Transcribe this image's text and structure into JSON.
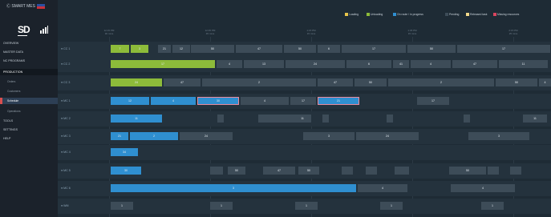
{
  "app": {
    "brand": "Ⓒ SMART MES",
    "logo_text": "SD"
  },
  "sidebar": {
    "items": [
      {
        "label": "OVERVIEW"
      },
      {
        "label": "MASTER DATA"
      },
      {
        "label": "NC PROGRAMS"
      },
      {
        "label": "PRODUCTION"
      },
      {
        "label": "Orders"
      },
      {
        "label": "Customers"
      },
      {
        "label": "Schedule"
      },
      {
        "label": "Operations"
      },
      {
        "label": "TOOLS"
      },
      {
        "label": "SETTINGS"
      },
      {
        "label": "HELP"
      }
    ]
  },
  "legend": {
    "items": [
      {
        "label": "Loading",
        "color": "#e8c54a"
      },
      {
        "label": "Unloading",
        "color": "#8dbb3a"
      },
      {
        "label": "On route / in progress",
        "color": "#2f8fd0"
      },
      {
        "label": "Pending",
        "color": "#3d4c58"
      },
      {
        "label": "Released task",
        "color": "#f2d98a"
      },
      {
        "label": "Missing resources",
        "color": "#d9455f"
      }
    ]
  },
  "timeline": {
    "ticks": [
      {
        "time": "12:15 PM",
        "sub": "30 mins"
      },
      {
        "time": "12:45 PM",
        "sub": "45 mins"
      },
      {
        "time": "1:15 PM",
        "sub": "15 mins"
      },
      {
        "time": "1:45 PM",
        "sub": "15 mins"
      },
      {
        "time": "2:15 PM",
        "sub": "25 mins"
      }
    ]
  },
  "rows": [
    {
      "label": "● CC 1",
      "bars": [
        {
          "text": "7",
          "kind": "g"
        },
        {
          "text": "3",
          "kind": "g"
        },
        {
          "text": "21",
          "kind": "d"
        },
        {
          "text": "12",
          "kind": "d"
        },
        {
          "text": "50",
          "kind": "d"
        },
        {
          "text": "47",
          "kind": "d"
        },
        {
          "text": "50",
          "kind": "d"
        },
        {
          "text": "6",
          "kind": "d"
        },
        {
          "text": "17",
          "kind": "d"
        },
        {
          "text": "50",
          "kind": "d"
        },
        {
          "text": "17",
          "kind": "d"
        }
      ]
    },
    {
      "label": "● CC 2",
      "bars": [
        {
          "text": "17",
          "kind": "g"
        },
        {
          "text": "4",
          "kind": "d"
        },
        {
          "text": "13",
          "kind": "d"
        },
        {
          "text": "24",
          "kind": "d"
        },
        {
          "text": "6",
          "kind": "d"
        },
        {
          "text": "41",
          "kind": "d"
        },
        {
          "text": "4",
          "kind": "d"
        },
        {
          "text": "47",
          "kind": "d"
        },
        {
          "text": "11",
          "kind": "d"
        }
      ]
    },
    {
      "label": "● CC 3",
      "bars": [
        {
          "text": "24",
          "kind": "g"
        },
        {
          "text": "47",
          "kind": "d"
        },
        {
          "text": "2",
          "kind": "d"
        },
        {
          "text": "47",
          "kind": "d"
        },
        {
          "text": "50",
          "kind": "d"
        },
        {
          "text": "2",
          "kind": "d"
        },
        {
          "text": "50",
          "kind": "d"
        },
        {
          "text": "4",
          "kind": "d"
        }
      ]
    },
    {
      "label": "● MC 1",
      "bars": [
        {
          "text": "12",
          "kind": "b"
        },
        {
          "text": "4",
          "kind": "b"
        },
        {
          "text": "30",
          "kind": "hl"
        },
        {
          "text": "4",
          "kind": "d"
        },
        {
          "text": "17",
          "kind": "d"
        },
        {
          "text": "21",
          "kind": "hl"
        },
        {
          "text": "17",
          "kind": "d"
        }
      ]
    },
    {
      "label": "● MC 2",
      "bars": [
        {
          "text": "11",
          "kind": "b"
        },
        {
          "text": "",
          "kind": "d"
        },
        {
          "text": "",
          "kind": "d"
        },
        {
          "text": "11",
          "kind": "d"
        },
        {
          "text": "",
          "kind": "d"
        },
        {
          "text": "",
          "kind": "d"
        },
        {
          "text": "",
          "kind": "d"
        },
        {
          "text": "11",
          "kind": "d"
        }
      ]
    },
    {
      "label": "● MC 3",
      "bars": [
        {
          "text": "21",
          "kind": "b"
        },
        {
          "text": "2",
          "kind": "b"
        },
        {
          "text": "24",
          "kind": "d"
        },
        {
          "text": "3",
          "kind": "d"
        },
        {
          "text": "24",
          "kind": "d"
        },
        {
          "text": "3",
          "kind": "d"
        }
      ]
    },
    {
      "label": "● MC 4",
      "bars": [
        {
          "text": "34",
          "kind": "b"
        }
      ]
    },
    {
      "label": "● MC 5",
      "bars": [
        {
          "text": "30",
          "kind": "b"
        },
        {
          "text": "",
          "kind": "d"
        },
        {
          "text": "50",
          "kind": "d"
        },
        {
          "text": "47",
          "kind": "d"
        },
        {
          "text": "50",
          "kind": "d"
        },
        {
          "text": "",
          "kind": "d"
        },
        {
          "text": "",
          "kind": "d"
        },
        {
          "text": "",
          "kind": "d"
        },
        {
          "text": "50",
          "kind": "d"
        },
        {
          "text": "",
          "kind": "d"
        },
        {
          "text": "",
          "kind": "d"
        }
      ]
    },
    {
      "label": "● MC 6",
      "bars": [
        {
          "text": "3",
          "kind": "b"
        },
        {
          "text": "4",
          "kind": "d"
        },
        {
          "text": "4",
          "kind": "d"
        }
      ]
    },
    {
      "label": "● WM",
      "bars": [
        {
          "text": "1",
          "kind": "d"
        },
        {
          "text": "1",
          "kind": "d"
        },
        {
          "text": "1",
          "kind": "d"
        },
        {
          "text": "1",
          "kind": "d"
        },
        {
          "text": "1",
          "kind": "d"
        }
      ]
    }
  ]
}
